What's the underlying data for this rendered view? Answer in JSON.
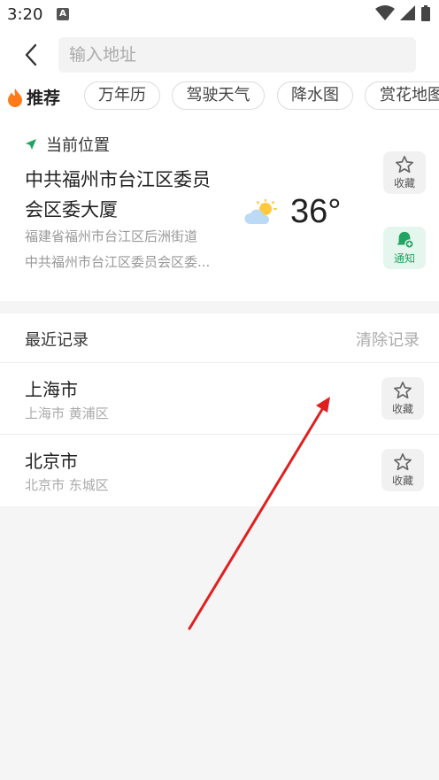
{
  "status_bar": {
    "time": "3:20",
    "notification_icon": "a-box-icon"
  },
  "search": {
    "placeholder": "输入地址"
  },
  "tabs": {
    "recommended": "推荐",
    "items": [
      "万年历",
      "驾驶天气",
      "降水图",
      "赏花地图"
    ]
  },
  "current_location": {
    "header": "当前位置",
    "name": "中共福州市台江区委员会区委大厦",
    "address": "福建省福州市台江区后洲街道",
    "full_name": "中共福州市台江区委员会区委...",
    "weather_icon": "partly-sunny-icon",
    "temperature": "36°",
    "favorite_label": "收藏",
    "notify_label": "通知"
  },
  "recent": {
    "title": "最近记录",
    "clear_label": "清除记录",
    "items": [
      {
        "name": "上海市",
        "sub": "上海市 黄浦区",
        "favorite_label": "收藏"
      },
      {
        "name": "北京市",
        "sub": "北京市 东城区",
        "favorite_label": "收藏"
      }
    ]
  },
  "colors": {
    "accent_green": "#1fa561",
    "annotation_red": "#e02020",
    "flame_orange": "#ff7a1a"
  }
}
